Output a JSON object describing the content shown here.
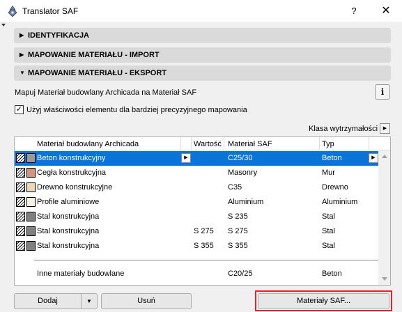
{
  "window": {
    "title": "Translator SAF",
    "help_label": "?",
    "close_label": "✕",
    "icon": "translator-app-icon"
  },
  "sections": [
    {
      "label": "IDENTYFIKACJA",
      "expanded": false
    },
    {
      "label": "MAPOWANIE MATERIAŁU - IMPORT",
      "expanded": false
    },
    {
      "label": "MAPOWANIE MATERIAŁU - EKSPORT",
      "expanded": true
    }
  ],
  "export": {
    "description": "Mapuj Materiał budowlany Archicada na Materiał SAF",
    "info_label": "i",
    "checkbox_label": "Użyj właściwości elementu dla bardziej precyzyjnego mapowania",
    "checkbox_checked": true,
    "klasa_label": "Klasa wytrzymałości"
  },
  "table": {
    "headers": {
      "material": "Materiał budowlany Archicada",
      "value": "Wartość",
      "saf": "Materiał SAF",
      "type": "Typ"
    },
    "rows": [
      {
        "material": "Beton konstrukcyjny",
        "value": "",
        "saf": "C25/30",
        "type": "Beton",
        "color": "#9a9a9a",
        "selected": true
      },
      {
        "material": "Cegła konstrukcyjna",
        "value": "",
        "saf": "Masonry",
        "type": "Mur",
        "color": "#d59480",
        "selected": false
      },
      {
        "material": "Drewno konstrukcyjne",
        "value": "",
        "saf": "C35",
        "type": "Drewno",
        "color": "#ecd9b8",
        "selected": false
      },
      {
        "material": "Profile aluminiowe",
        "value": "",
        "saf": "Aluminium",
        "type": "Aluminium",
        "color": "#f6f0e2",
        "selected": false
      },
      {
        "material": "Stal konstrukcyjna",
        "value": "",
        "saf": "S 235",
        "type": "Stal",
        "color": "#808080",
        "selected": false
      },
      {
        "material": "Stal konstrukcyjna",
        "value": "S 275",
        "saf": "S 275",
        "type": "Stal",
        "color": "#808080",
        "selected": false
      },
      {
        "material": "Stal konstrukcyjna",
        "value": "S 355",
        "saf": "S 355",
        "type": "Stal",
        "color": "#808080",
        "selected": false
      }
    ],
    "other": {
      "material": "Inne materiały budowlane",
      "saf": "C20/25",
      "type": "Beton"
    }
  },
  "buttons": {
    "add": "Dodaj",
    "remove": "Usuń",
    "saf_materials": "Materiały SAF..."
  },
  "colors": {
    "selection": "#0a74d8",
    "focus": "#e3242b",
    "section_bg": "#dadada"
  }
}
